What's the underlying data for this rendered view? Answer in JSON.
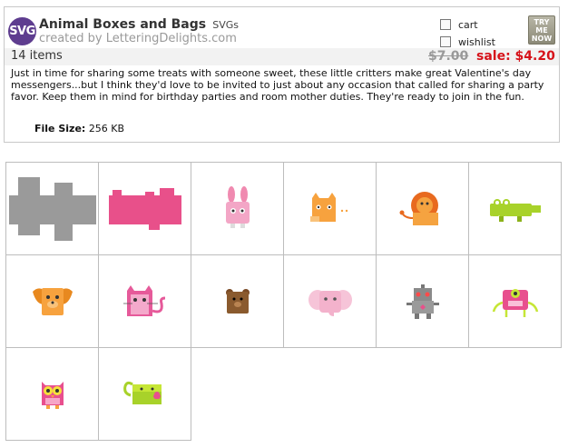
{
  "product": {
    "badge": "SVG",
    "title": "Animal Boxes and Bags",
    "title_tag": "SVGs",
    "creator": "created by LetteringDelights.com",
    "item_count": "14 items",
    "price_old": "$7.00",
    "price_sale": "sale: $4.20",
    "description": "Just in time for sharing some treats with someone sweet, these little critters make great Valentine's day messengers...but I think they'd love to be invited to just about any occasion that called for sharing a party favor. Keep them in mind for birthday parties and room mother duties. They're ready to join in the fun.",
    "file_size_label": "File Size:",
    "file_size_value": "256 KB"
  },
  "actions": {
    "cart_label": "cart",
    "wishlist_label": "wishlist",
    "try_me_now": [
      "TRY",
      "ME",
      "NOW"
    ]
  },
  "colors": {
    "badge_bg": "#5e3d8f",
    "sale": "#d6121a",
    "old_price": "#999999",
    "band": "#f2f2f2"
  },
  "thumbnails": [
    {
      "icon": "gray-box-template-icon"
    },
    {
      "icon": "pink-bag-template-icon"
    },
    {
      "icon": "pink-bunny-icon"
    },
    {
      "icon": "orange-cat-icon"
    },
    {
      "icon": "orange-lion-icon"
    },
    {
      "icon": "green-crocodile-icon"
    },
    {
      "icon": "orange-dog-icon"
    },
    {
      "icon": "pink-cat-icon"
    },
    {
      "icon": "brown-bear-icon"
    },
    {
      "icon": "pink-elephant-icon"
    },
    {
      "icon": "gray-robot-icon"
    },
    {
      "icon": "pink-monster-icon"
    },
    {
      "icon": "pink-owl-icon"
    },
    {
      "icon": "green-monkey-icon"
    }
  ]
}
